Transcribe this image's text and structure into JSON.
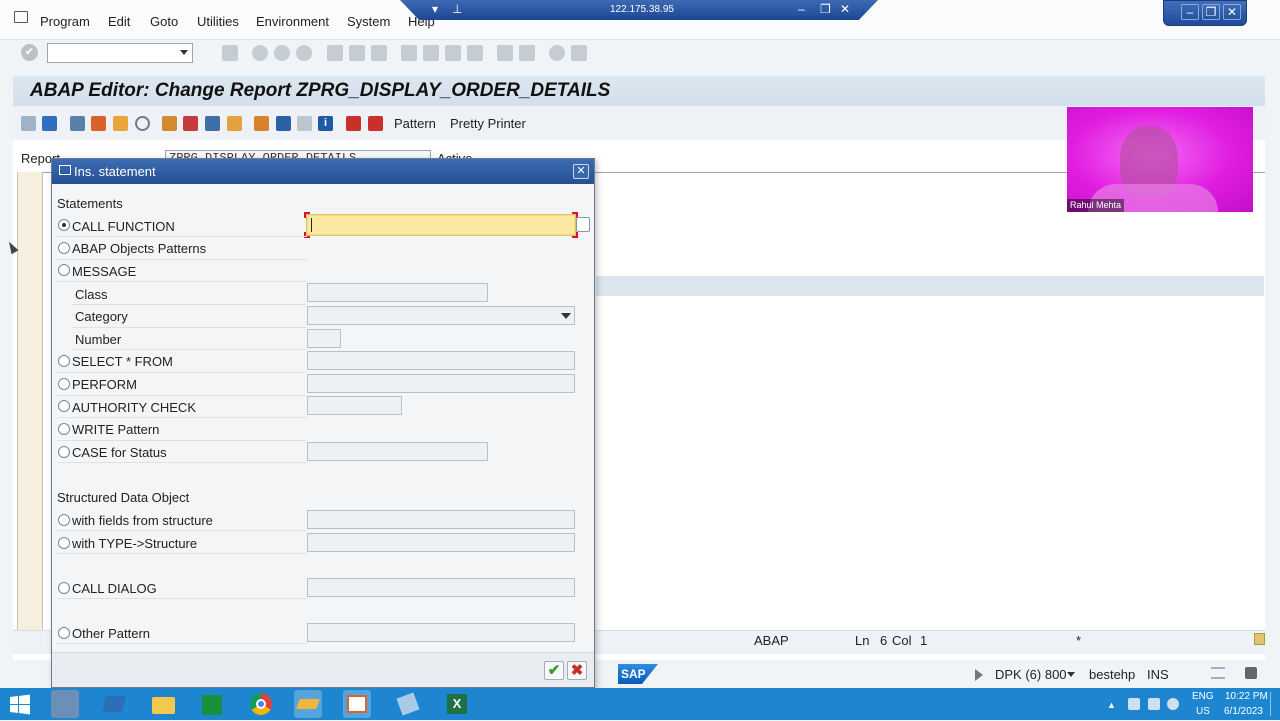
{
  "menu": {
    "items": [
      "Program",
      "Edit",
      "Goto",
      "Utilities",
      "Environment",
      "System",
      "Help"
    ]
  },
  "remote": {
    "ip": "122.175.38.95"
  },
  "window": {
    "title": "ABAP Editor: Change Report ZPRG_DISPLAY_ORDER_DETAILS"
  },
  "app_toolbar": {
    "pattern_label": "Pattern",
    "pretty_printer_label": "Pretty Printer"
  },
  "report": {
    "label": "Report",
    "value": "ZPRG_DISPLAY_ORDER_DETAILS",
    "status": "Active"
  },
  "webcam": {
    "name": "Rahul Mehta"
  },
  "dialog": {
    "title": "Ins. statement",
    "section_statements": "Statements",
    "section_structured": "Structured Data Object",
    "options": {
      "call_function": "CALL FUNCTION",
      "abap_objects": "ABAP Objects Patterns",
      "message": "MESSAGE",
      "class": "Class",
      "category": "Category",
      "number": "Number",
      "select": "SELECT * FROM",
      "perform": "PERFORM",
      "authority": "AUTHORITY CHECK",
      "write": "WRITE Pattern",
      "case": "CASE for Status",
      "with_fields": "with fields from structure",
      "with_type": "with TYPE->Structure",
      "call_dialog": "CALL DIALOG",
      "other": "Other Pattern"
    },
    "selected": "call_function",
    "call_function_value": ""
  },
  "status_bar": {
    "lang": "ABAP",
    "ln_label": "Ln",
    "ln_value": "6",
    "col_label": "Col",
    "col_value": "1",
    "star": "*"
  },
  "bottom_bar": {
    "logo": "SAP",
    "system": "DPK (6) 800",
    "server": "bestehp",
    "mode": "INS"
  },
  "taskbar": {
    "lang": "ENG",
    "region": "US",
    "time": "10:22 PM",
    "date": "6/1/2023"
  },
  "colors": {
    "accent": "#264f93",
    "taskbar": "#1e86d1",
    "highlight_field": "#fbe9a3",
    "webcam": "#e01ee0"
  }
}
